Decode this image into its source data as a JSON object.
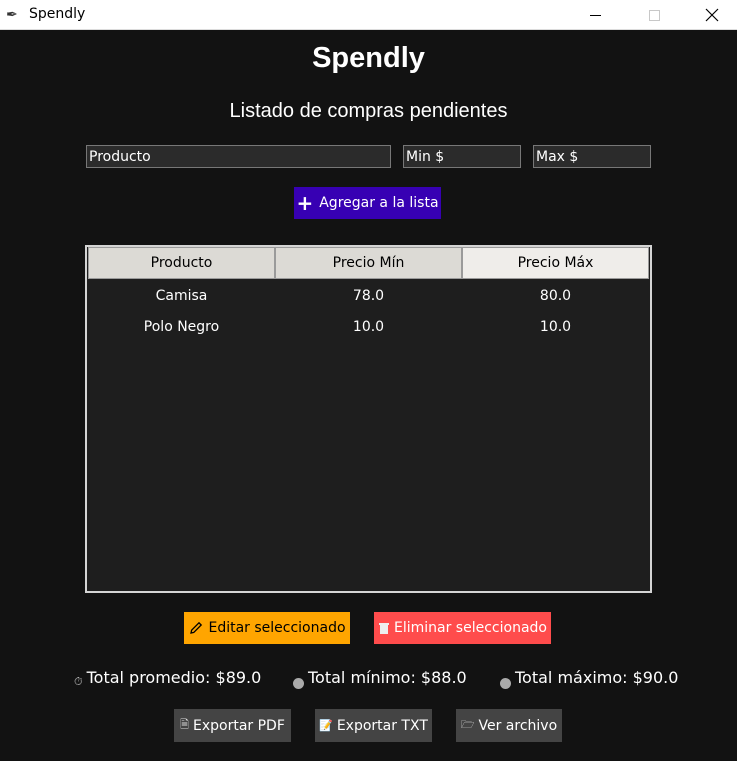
{
  "window": {
    "title": "Spendly",
    "app_icon": "feather-icon"
  },
  "header": {
    "title": "Spendly",
    "subtitle": "Listado de compras pendientes"
  },
  "form": {
    "product_value": "Producto",
    "min_value": "Min $",
    "max_value": "Max $",
    "add_label": "Agregar a la lista"
  },
  "table": {
    "columns": [
      "Producto",
      "Precio Mín",
      "Precio Máx"
    ],
    "rows": [
      [
        "Camisa",
        "78.0",
        "80.0"
      ],
      [
        "Polo Negro",
        "10.0",
        "10.0"
      ]
    ]
  },
  "actions": {
    "edit_label": "Editar seleccionado",
    "delete_label": "Eliminar seleccionado"
  },
  "totals": {
    "promedio": "Total promedio: $89.0",
    "minimo": "Total mínimo: $88.0",
    "maximo": "Total máximo: $90.0"
  },
  "export": {
    "pdf_label": "Exportar PDF",
    "txt_label": "Exportar TXT",
    "file_label": "Ver archivo"
  },
  "colors": {
    "background": "#121212",
    "add_button": "#3700b3",
    "edit_button": "#ffa500",
    "delete_button": "#ff4c4c",
    "export_button": "#444444"
  }
}
